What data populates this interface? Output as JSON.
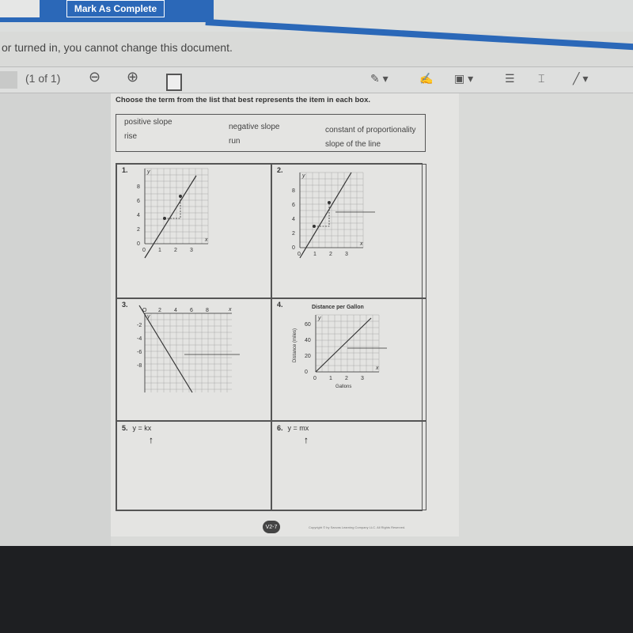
{
  "header": {
    "mark_complete": "Mark As Complete",
    "notice": "or turned in, you cannot change this document."
  },
  "toolbar": {
    "page_indicator": "(1 of 1)",
    "icons": [
      "zoom-out-icon",
      "zoom-in-icon",
      "fit-page-icon",
      "highlighter-icon",
      "signature-icon",
      "image-icon",
      "note-icon",
      "text-box-icon",
      "line-icon"
    ]
  },
  "worksheet": {
    "instruction": "Choose the term from the list that best represents the item in each box.",
    "terms": [
      "positive slope",
      "negative slope",
      "constant of proportionality",
      "rise",
      "run",
      "slope of the line"
    ],
    "problems": [
      {
        "number": "1.",
        "x_ticks": [
          "0",
          "1",
          "2",
          "3"
        ],
        "y_ticks": [
          "0",
          "2",
          "4",
          "6",
          "8"
        ],
        "x_label": "x",
        "y_label": "y"
      },
      {
        "number": "2.",
        "x_ticks": [
          "0",
          "1",
          "2",
          "3"
        ],
        "y_ticks": [
          "0",
          "2",
          "4",
          "6",
          "8"
        ],
        "x_label": "x",
        "y_label": "y"
      },
      {
        "number": "3.",
        "x_ticks": [
          "O",
          "2",
          "4",
          "6",
          "8"
        ],
        "y_ticks": [
          "-2",
          "-4",
          "-6",
          "-8"
        ],
        "x_label": "x",
        "y_label": "y"
      },
      {
        "number": "4.",
        "title": "Distance per Gallon",
        "x_ticks": [
          "0",
          "1",
          "2",
          "3"
        ],
        "y_ticks": [
          "0",
          "20",
          "40",
          "60"
        ],
        "x_label": "Gallons",
        "y_label": "Distance (miles)",
        "x_var": "x",
        "y_var": "y"
      },
      {
        "number": "5.",
        "equation": "y = kx"
      },
      {
        "number": "6.",
        "equation": "y = mx"
      }
    ],
    "page_badge": "V2-7",
    "copyright": "Copyright © by Savvas Learning Company LLC. All Rights Reserved."
  }
}
